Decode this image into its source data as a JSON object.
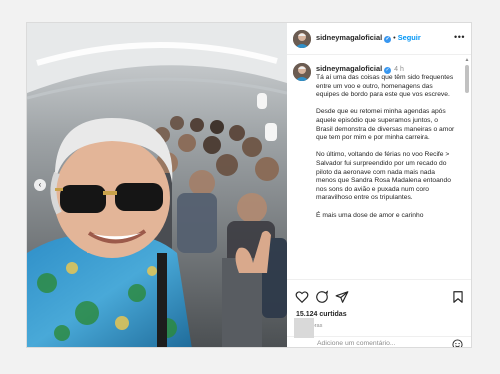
{
  "post": {
    "username": "sidneymagaloficial",
    "follow_label": "Seguir",
    "separator": "•",
    "time_ago": "4 h",
    "caption_paragraphs": [
      "Tá aí uma das coisas que têm sido frequentes entre um voo e outro, homenagens das equipes de bordo para este que vos escreve.",
      "Desde que eu retomei minha agendas após aquele episódio que superamos juntos, o Brasil demonstra de diversas maneiras o amor que tem por mim e por minha carreira.",
      "No último, voltando de férias no voo Recife > Salvador fui surpreendido por um recado do piloto da aeronave com nada mais nada menos que Sandra Rosa Madalena entoando nos sons do avião e puxada num coro maravilhoso entre os tripulantes.",
      "É mais uma dose de amor e carinho"
    ],
    "likes": "15.124 curtidas",
    "posted": "há 4 horas",
    "comment_placeholder": "Adicione um comentário...",
    "more_label": "•••",
    "prev_label": "‹"
  },
  "icons": {
    "heart": "heart-icon",
    "comment": "comment-icon",
    "share": "share-icon",
    "save": "bookmark-icon",
    "emoji": "emoji-icon",
    "verified": "verified-icon"
  },
  "colors": {
    "accent": "#0095f6",
    "verified": "#3897f0",
    "text": "#262626",
    "muted": "#8e8e8e"
  }
}
